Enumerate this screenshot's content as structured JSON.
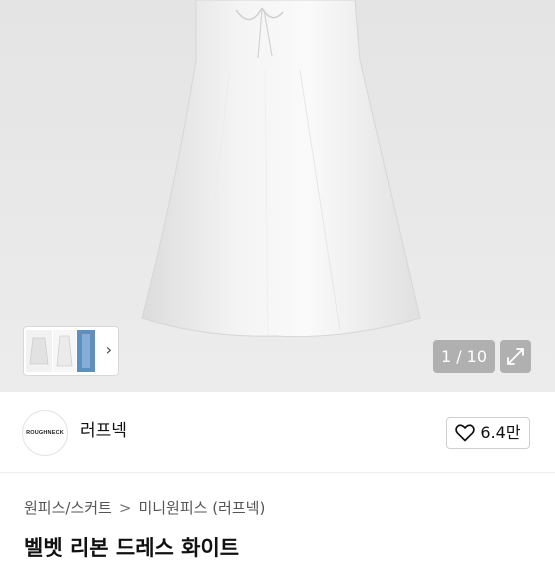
{
  "gallery": {
    "counter": "1 / 10",
    "expand_icon": "expand-icon",
    "next_icon": "chevron-right-icon"
  },
  "seller": {
    "logo_text": "ROUGHNECK",
    "name": "러프넥",
    "like_icon": "heart-outline-icon",
    "like_count": "6.4만"
  },
  "breadcrumb": {
    "items": [
      "원피스/스커트",
      "미니원피스 (러프넥)"
    ],
    "separator": ">"
  },
  "product": {
    "title": "벨벳 리본 드레스 화이트"
  }
}
